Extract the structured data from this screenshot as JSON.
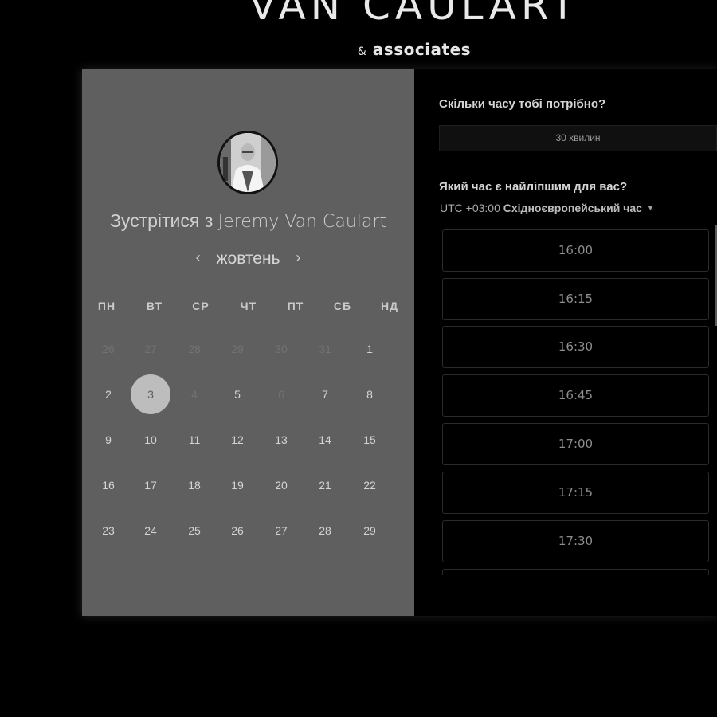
{
  "brand": {
    "title": "VAN CAULART",
    "amp": "&",
    "subtitle": "associates"
  },
  "meeting": {
    "prefix": "Зустрітися з",
    "name": "Jeremy Van Caulart"
  },
  "calendar": {
    "month": "жовтень",
    "prev_icon": "‹",
    "next_icon": "›",
    "weekdays": [
      "ПН",
      "ВТ",
      "СР",
      "ЧТ",
      "ПТ",
      "СБ",
      "НД"
    ],
    "weeks": [
      [
        "26",
        "27",
        "28",
        "29",
        "30",
        "31",
        "1"
      ],
      [
        "2",
        "3",
        "4",
        "5",
        "6",
        "7",
        "8"
      ],
      [
        "9",
        "10",
        "11",
        "12",
        "13",
        "14",
        "15"
      ],
      [
        "16",
        "17",
        "18",
        "19",
        "20",
        "21",
        "22"
      ],
      [
        "23",
        "24",
        "25",
        "26",
        "27",
        "28",
        "29"
      ]
    ],
    "selected": "3"
  },
  "duration": {
    "question": "Скільки часу тобі потрібно?",
    "value": "30 хвилин"
  },
  "time": {
    "question": "Який час є найліпшим для вас?",
    "tz_offset": "UTC +03:00",
    "tz_name": "Східноєвропейський час",
    "slots": [
      "16:00",
      "16:15",
      "16:30",
      "16:45",
      "17:00",
      "17:15",
      "17:30"
    ]
  }
}
